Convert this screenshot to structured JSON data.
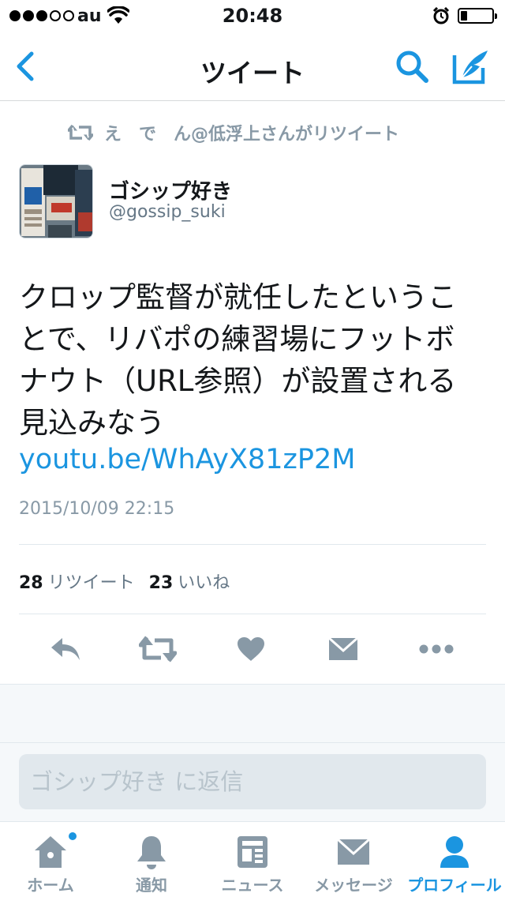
{
  "status_bar": {
    "carrier": "au",
    "time": "20:48",
    "signal_bars_filled": 3,
    "signal_bars_total": 5
  },
  "nav": {
    "title": "ツイート",
    "back_icon": "chevron-left-icon",
    "search_icon": "search-icon",
    "compose_icon": "compose-quill-icon"
  },
  "retweet_context": {
    "text": "え　で　ん@低浮上さんがリツイート"
  },
  "tweet": {
    "author_name": "ゴシップ好き",
    "author_handle": "@gossip_suki",
    "text": "クロップ監督が就任したということで、リバポの練習場にフットボナウト（URL参照）が設置される見込みなう",
    "link": "youtu.be/WhAyX81zP2M",
    "timestamp": "2015/10/09 22:15",
    "retweet_count": "28",
    "retweet_label": "リツイート",
    "like_count": "23",
    "like_label": "いいね"
  },
  "reply": {
    "placeholder": "ゴシップ好き に返信"
  },
  "tabs": [
    {
      "label": "ホーム",
      "icon": "home-icon"
    },
    {
      "label": "通知",
      "icon": "bell-icon"
    },
    {
      "label": "ニュース",
      "icon": "news-icon"
    },
    {
      "label": "メッセージ",
      "icon": "envelope-icon"
    },
    {
      "label": "プロフィール",
      "icon": "person-icon"
    }
  ],
  "colors": {
    "accent": "#1b95e0",
    "icon_gray": "#8899a6"
  }
}
